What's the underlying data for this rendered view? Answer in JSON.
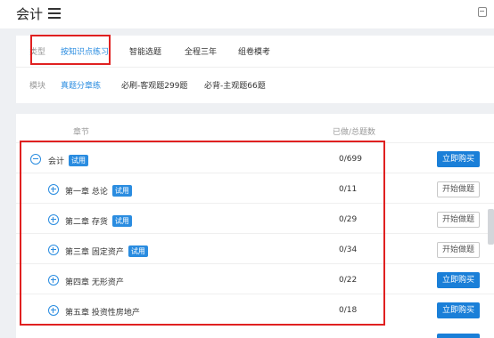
{
  "header": {
    "title": "会计",
    "menu_icon": "hamburger-menu-icon",
    "note_icon": "note-icon"
  },
  "filters": {
    "type_label": "类型",
    "type_options": [
      "按知识点练习",
      "智能选题",
      "全程三年",
      "组卷模考"
    ],
    "type_active": 0,
    "module_label": "模块",
    "module_options": [
      "真题分章练",
      "必刷-客观题299题",
      "必背-主观题66题"
    ],
    "module_active": 0
  },
  "list": {
    "col_chapter": "章节",
    "col_count": "已做/总题数",
    "rows": [
      {
        "name": "会计",
        "tag": "试用",
        "count": "0/699",
        "button": "立即购买",
        "icon": "collapse-minus-icon"
      },
      {
        "name": "第一章 总论",
        "tag": "试用",
        "count": "0/11",
        "button": "开始做题",
        "icon": "expand-plus-icon"
      },
      {
        "name": "第二章 存货",
        "tag": "试用",
        "count": "0/29",
        "button": "开始做题",
        "icon": "expand-plus-icon"
      },
      {
        "name": "第三章 固定资产",
        "tag": "试用",
        "count": "0/34",
        "button": "开始做题",
        "icon": "expand-plus-icon"
      },
      {
        "name": "第四章 无形资产",
        "tag": "",
        "count": "0/22",
        "button": "立即购买",
        "icon": "expand-plus-icon"
      },
      {
        "name": "第五章 投资性房地产",
        "tag": "",
        "count": "0/18",
        "button": "立即购买",
        "icon": "expand-plus-icon"
      }
    ]
  },
  "colors": {
    "accent": "#2a8ce0",
    "buy_button": "#1a7fd8",
    "highlight_box": "#e02020",
    "background": "#eef0f3"
  }
}
